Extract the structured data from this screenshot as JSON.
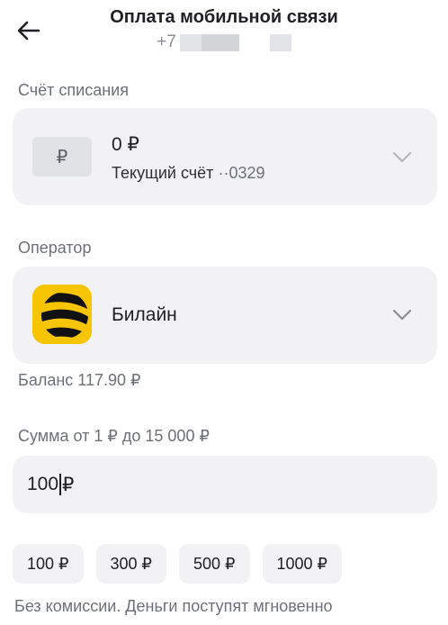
{
  "header": {
    "title": "Оплата мобильной связи",
    "phone_prefix": "+7"
  },
  "account": {
    "section_label": "Счёт списания",
    "currency_icon": "₽",
    "amount": "0 ₽",
    "name": "Текущий счёт",
    "number": "··0329"
  },
  "operator": {
    "section_label": "Оператор",
    "logo_icon": "beeline-logo-icon",
    "name": "Билайн",
    "balance": "Баланс 117.90 ₽"
  },
  "amount": {
    "label": "Сумма от 1 ₽ до 15 000 ₽",
    "value": "100",
    "currency": "₽"
  },
  "quick_amounts": [
    {
      "label": "100 ₽"
    },
    {
      "label": "300 ₽"
    },
    {
      "label": "500 ₽"
    },
    {
      "label": "1000 ₽"
    }
  ],
  "footer": {
    "note": "Без комиссии. Деньги поступят мгновенно"
  },
  "colors": {
    "card_bg": "#f2f2f4",
    "muted_text": "#6e7079",
    "brand_yellow": "#f7c400"
  }
}
